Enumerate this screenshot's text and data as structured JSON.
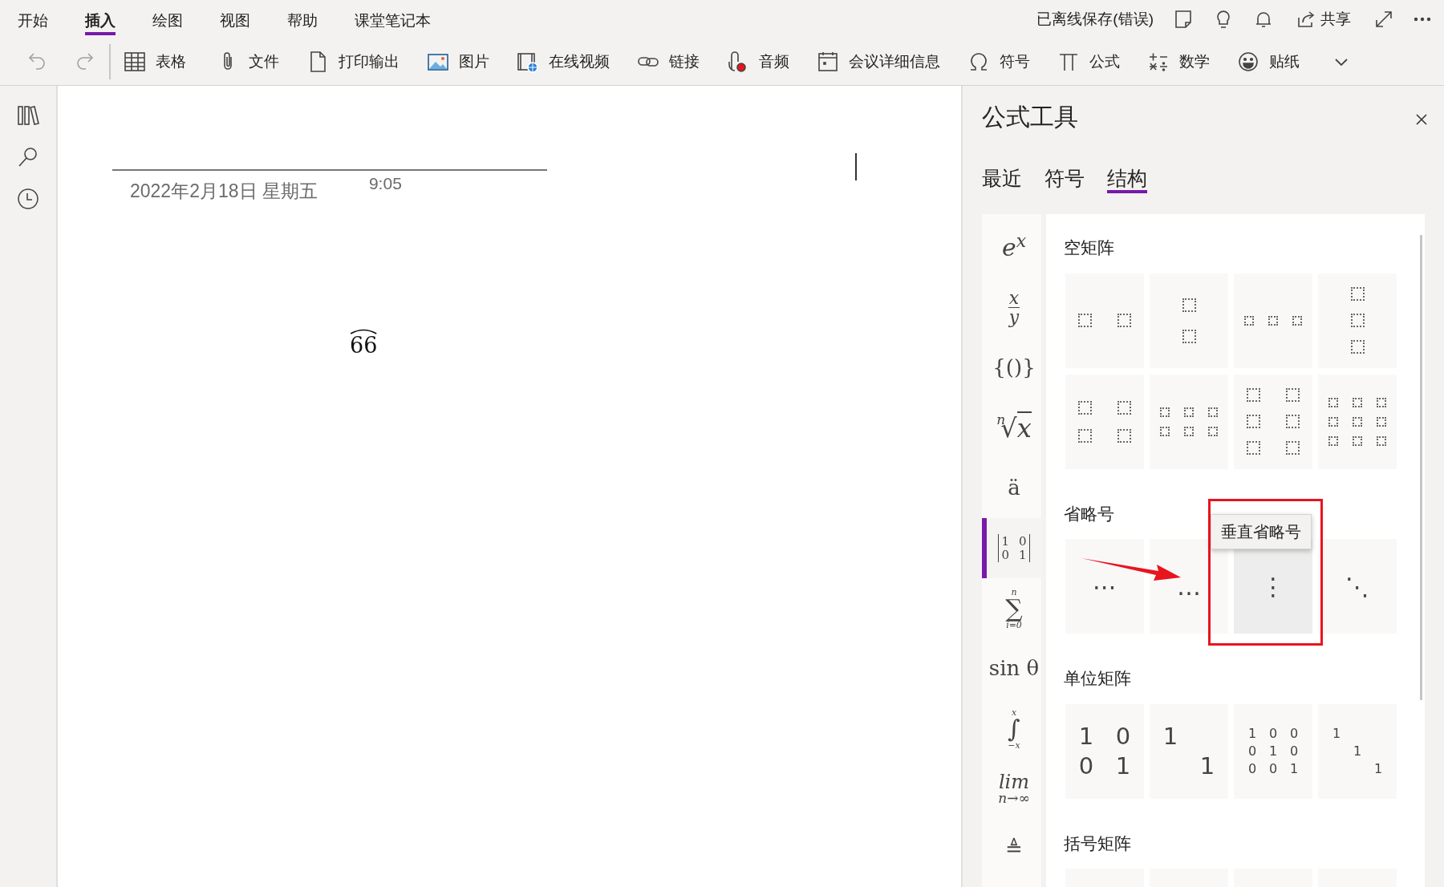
{
  "ribbon_tabs": [
    {
      "label": "开始",
      "selected": false
    },
    {
      "label": "插入",
      "selected": true
    },
    {
      "label": "绘图",
      "selected": false
    },
    {
      "label": "视图",
      "selected": false
    },
    {
      "label": "帮助",
      "selected": false
    },
    {
      "label": "课堂笔记本",
      "selected": false
    }
  ],
  "save_status": "已离线保存(错误)",
  "share_label": "共享",
  "history": [
    {
      "disabled": true
    },
    {
      "disabled": true
    }
  ],
  "toolbar": [
    {
      "label": "表格"
    },
    {
      "label": "文件"
    },
    {
      "label": "打印输出"
    },
    {
      "label": "图片"
    },
    {
      "label": "在线视频"
    },
    {
      "label": "链接"
    },
    {
      "label": "音频"
    },
    {
      "label": "会议详细信息"
    },
    {
      "label": "符号"
    },
    {
      "label": "公式"
    },
    {
      "label": "数学"
    },
    {
      "label": "贴纸"
    }
  ],
  "page": {
    "date": "2022年2月18日 星期五",
    "time": "9:05",
    "equation": "66"
  },
  "panel": {
    "title": "公式工具",
    "tabs": [
      {
        "label": "最近",
        "selected": false
      },
      {
        "label": "符号",
        "selected": false
      },
      {
        "label": "结构",
        "selected": true
      }
    ],
    "categories": [
      {
        "kind": "script",
        "base": "e",
        "sup": "x",
        "selected": false
      },
      {
        "kind": "fraction",
        "top": "x",
        "bottom": "y",
        "selected": false
      },
      {
        "kind": "plain",
        "text": "{()}",
        "selected": false
      },
      {
        "kind": "radical",
        "index": "n",
        "sign": "√",
        "body": "x",
        "selected": false
      },
      {
        "kind": "plain",
        "text": "ä",
        "selected": false
      },
      {
        "kind": "matrix",
        "cells": [
          "1",
          "0",
          "0",
          "1"
        ],
        "selected": true
      },
      {
        "kind": "operator",
        "symbol": "∑",
        "upper": "n",
        "lower": "i=0",
        "selected": false
      },
      {
        "kind": "plain",
        "text": "sin θ",
        "selected": false
      },
      {
        "kind": "operator",
        "symbol": "∫",
        "upper": "x",
        "lower": "−x",
        "selected": false
      },
      {
        "kind": "limit",
        "text": "lim",
        "below": "n→∞",
        "selected": false
      },
      {
        "kind": "plain",
        "text": "≜",
        "selected": false
      }
    ],
    "sections": [
      {
        "title": "空矩阵",
        "tiles": [
          {
            "kind": "empty"
          },
          {
            "kind": "empty"
          },
          {
            "kind": "empty"
          },
          {
            "kind": "empty"
          },
          {
            "kind": "empty"
          },
          {
            "kind": "empty"
          },
          {
            "kind": "empty"
          },
          {
            "kind": "empty"
          }
        ]
      },
      {
        "title": "省略号",
        "tiles": [
          {
            "kind": "symbol",
            "text": "⋯",
            "hovered": false
          },
          {
            "kind": "symbol",
            "text": "…",
            "hovered": false
          },
          {
            "kind": "symbol",
            "text": "⋮",
            "hovered": true,
            "tooltip": "垂直省略号"
          },
          {
            "kind": "symbol",
            "text": "⋱",
            "hovered": false
          }
        ],
        "annotations": [
          {
            "kind": "arrow"
          },
          {
            "kind": "frame"
          }
        ]
      },
      {
        "title": "单位矩阵",
        "tiles": [
          {
            "kind": "full",
            "cells": [
              "1",
              "0",
              "0",
              "1"
            ]
          },
          {
            "kind": "diagonal",
            "cells": [
              "1",
              "1"
            ]
          },
          {
            "kind": "full",
            "cells": [
              "1",
              "0",
              "0",
              "0",
              "1",
              "0",
              "0",
              "0",
              "1"
            ]
          },
          {
            "kind": "diagonal",
            "cells": [
              "1",
              "1",
              "1"
            ]
          }
        ]
      },
      {
        "title": "括号矩阵"
      }
    ]
  }
}
